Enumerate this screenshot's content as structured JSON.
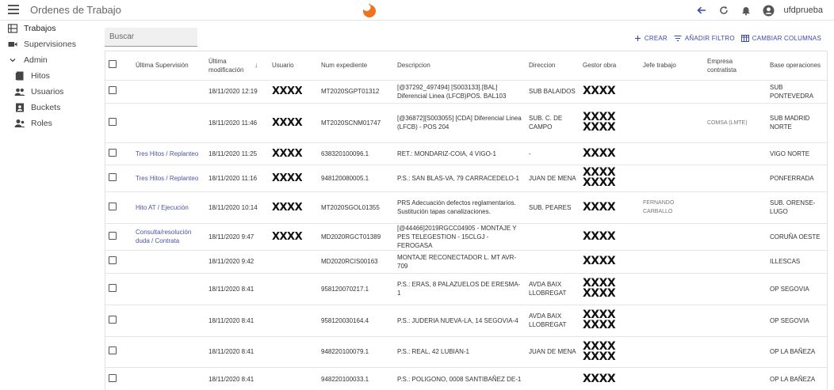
{
  "header": {
    "title": "Ordenes de Trabajo",
    "user": "ufdprueba",
    "brand_color": "#f0721e"
  },
  "sidebar": {
    "items": [
      {
        "label": "Trabajos",
        "icon": "list-icon"
      },
      {
        "label": "Supervisiones",
        "icon": "video-icon"
      },
      {
        "label": "Admin",
        "icon": "chevron-down-icon"
      },
      {
        "label": "Hitos",
        "icon": "book-icon"
      },
      {
        "label": "Usuarios",
        "icon": "people-icon"
      },
      {
        "label": "Buckets",
        "icon": "badge-icon"
      },
      {
        "label": "Roles",
        "icon": "person-icon"
      }
    ]
  },
  "search": {
    "placeholder": "Buscar"
  },
  "toolbar": {
    "create_label": "Crear",
    "filter_label": "Añadir filtro",
    "columns_label": "Cambiar columnas",
    "accent": "#3949ab"
  },
  "table": {
    "columns": [
      "Última Supervisión",
      "Última modificación",
      "Usuario",
      "Num expediente",
      "Descripcion",
      "Direccion",
      "Gestor obra",
      "Jefe trabajo",
      "Empresa contratista",
      "Base operaciones"
    ],
    "rows": [
      {
        "sup": "",
        "mod": "18/11/2020 12:19",
        "user": "XXXX",
        "exp": "MT2020SGPT01312",
        "desc": "[@37292_497494] [S003133].[BAL] Diferencial Linea (LFCB)POS. BAL103",
        "dir": "SUB BALAIDOS",
        "gestor": [
          "XXXX"
        ],
        "jefe": "",
        "empresa": "",
        "base": "SUB PONTEVEDRA"
      },
      {
        "sup": "",
        "mod": "18/11/2020 11:46",
        "user": "XXXX",
        "exp": "MT2020SCNM01747",
        "desc": "[@36872][S003055] [CDA] Diferencial Linea (LFCB) - POS 204",
        "dir": "SUB. C. DE CAMPO",
        "gestor": [
          "XXXX",
          "XXXX"
        ],
        "jefe": "",
        "empresa": "COMSA (LMTE)",
        "base": "SUB MADRID NORTE"
      },
      {
        "sup": "Tres Hitos / Replanteo",
        "mod": "18/11/2020 11:25",
        "user": "XXXX",
        "exp": "638320100096.1",
        "desc": "RET.: MONDARIZ-COIA, 4 VIGO-1",
        "dir": "-",
        "gestor": [
          "XXXX"
        ],
        "jefe": "",
        "empresa": "",
        "base": "VIGO NORTE"
      },
      {
        "sup": "Tres Hitos / Replanteo",
        "mod": "18/11/2020 11:16",
        "user": "XXXX",
        "exp": "948120080005.1",
        "desc": "P.S.: SAN BLAS-VA, 79 CARRACEDELO-1",
        "dir": "JUAN DE MENA",
        "gestor": [
          "XXXX",
          "XXXX"
        ],
        "jefe": "",
        "empresa": "",
        "base": "PONFERRADA"
      },
      {
        "sup": "Hito AT / Ejecución",
        "mod": "18/11/2020 10:14",
        "user": "XXXX",
        "exp": "MT2020SGOL01355",
        "desc": "PRS Adecuación defectos reglamentarios. Sustitución tapas canalizaciones.",
        "dir": "SUB. PEARES",
        "gestor": [
          "XXXX"
        ],
        "jefe": "FERNANDO CARBALLO",
        "empresa": "",
        "base": "SUB. ORENSE-LUGO"
      },
      {
        "sup": "Consulta/resolución duda / Contrata",
        "mod": "18/11/2020 9:47",
        "user": "XXXX",
        "exp": "MD2020RGCT01389",
        "desc": "[@44466]2019RGCC04905 - MONTAJE Y PES TELEGESTION - 15CLGJ - FEROGASA",
        "dir": "",
        "gestor": [
          "XXXX"
        ],
        "jefe": "",
        "empresa": "",
        "base": "CORUÑA OESTE"
      },
      {
        "sup": "",
        "mod": "18/11/2020 9:42",
        "user": "",
        "exp": "MD2020RCIS00163",
        "desc": "MONTAJE RECONECTADOR L. MT AVR-709",
        "dir": "",
        "gestor": [
          "XXXX"
        ],
        "jefe": "",
        "empresa": "",
        "base": "ILLESCAS"
      },
      {
        "sup": "",
        "mod": "18/11/2020 8:41",
        "user": "",
        "exp": "958120070217.1",
        "desc": "P.S.: ERAS, 8 PALAZUELOS DE ERESMA-1",
        "dir": "AVDA BAIX LLOBREGAT",
        "gestor": [
          "XXXX",
          "XXXX"
        ],
        "jefe": "",
        "empresa": "",
        "base": "OP SEGOVIA"
      },
      {
        "sup": "",
        "mod": "18/11/2020 8:41",
        "user": "",
        "exp": "958120030164.4",
        "desc": "P.S.: JUDERIA NUEVA-LA, 14 SEGOVIA-4",
        "dir": "AVDA BAIX LLOBREGAT",
        "gestor": [
          "XXXX",
          "XXXX"
        ],
        "jefe": "",
        "empresa": "",
        "base": "OP SEGOVIA"
      },
      {
        "sup": "",
        "mod": "18/11/2020 8:41",
        "user": "",
        "exp": "948220100079.1",
        "desc": "P.S.: REAL, 42 LUBIAN-1",
        "dir": "JUAN DE MENA",
        "gestor": [
          "XXXX",
          "XXXX"
        ],
        "jefe": "",
        "empresa": "",
        "base": "OP LA BAÑEZA"
      },
      {
        "sup": "",
        "mod": "18/11/2020 8:41",
        "user": "",
        "exp": "948220100033.1",
        "desc": "P.S.: POLIGONO, 0008 SANTIBAÑEZ DE-1",
        "dir": "",
        "gestor": [
          "XXXX"
        ],
        "jefe": "",
        "empresa": "",
        "base": "OP LA BAÑEZA"
      }
    ]
  }
}
